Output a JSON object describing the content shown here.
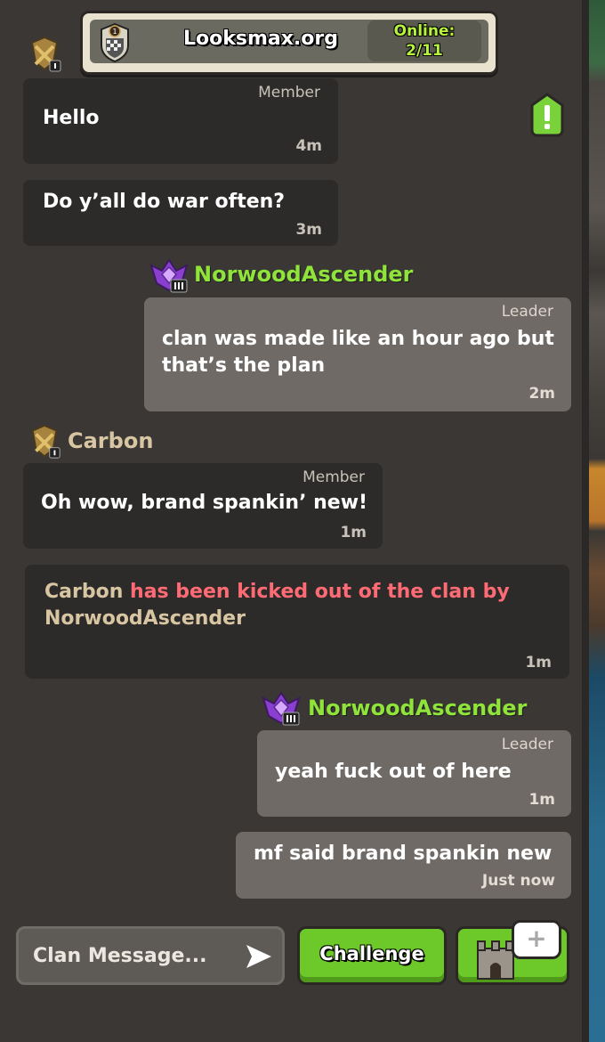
{
  "header": {
    "clan_name": "Looksmax.org",
    "online_label": "Online:",
    "online_count": "2/11"
  },
  "messages": [
    {
      "role": "Member",
      "text": "Hello",
      "time": "4m"
    },
    {
      "text": "Do y’all do war often?",
      "time": "3m"
    },
    {
      "sender": "NorwoodAscender",
      "role": "Leader",
      "text_lines": [
        "clan was made like an hour ago but",
        "that’s the plan"
      ],
      "time": "2m"
    },
    {
      "sender": "Carbon",
      "role": "Member",
      "text": "Oh wow, brand spankin’ new!",
      "time": "1m"
    },
    {
      "sender": "NorwoodAscender",
      "role": "Leader",
      "text": "yeah fuck out of here",
      "time": "1m"
    },
    {
      "text": "mf said brand spankin new",
      "time": "Just now"
    }
  ],
  "kick_notice": {
    "kicked": "Carbon",
    "action": " has been kicked out of the clan by",
    "by": "NorwoodAscender",
    "time": "1m"
  },
  "footer": {
    "input_placeholder": "Clan Message...",
    "challenge_label": "Challenge",
    "plus_label": "+"
  },
  "colors": {
    "leader_name": "#8fe33b",
    "member_name": "#d8c6a3",
    "kick_text": "#ff6b74",
    "button_green": "#6dc92a"
  }
}
